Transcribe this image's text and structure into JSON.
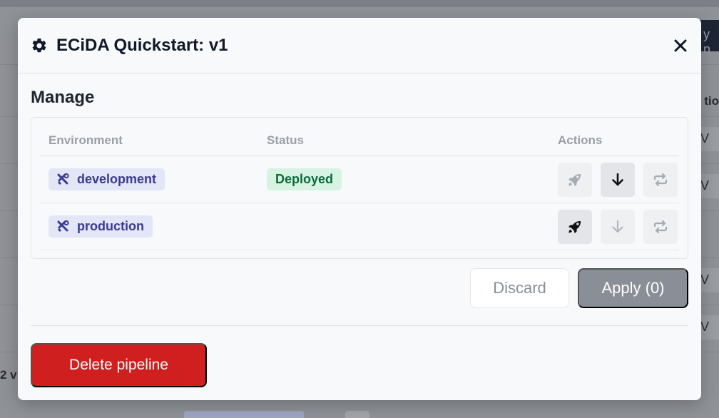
{
  "background": {
    "right_edge_text_1": "y n",
    "right_edge_text_2": "tio",
    "left_edge_text": "2 v",
    "row_v_letter": "V"
  },
  "modal": {
    "title": "ECiDA Quickstart: v1",
    "section_title": "Manage",
    "table": {
      "headers": {
        "environment": "Environment",
        "status": "Status",
        "actions": "Actions"
      },
      "rows": [
        {
          "environment": "development",
          "status": "Deployed"
        },
        {
          "environment": "production",
          "status": ""
        }
      ]
    },
    "discard_label": "Discard",
    "apply_label": "Apply (0)",
    "delete_label": "Delete pipeline"
  },
  "colors": {
    "delete": "#d01f1f",
    "env_chip_bg": "#e2e6f7",
    "env_chip_text": "#3c3a95",
    "status_bg": "#d7f4e3",
    "status_text": "#0c6a3b",
    "apply_disabled": "#8a8e96"
  },
  "icons": {
    "title": "gear-icon",
    "close": "close-icon",
    "env": "tools-icon",
    "deploy": "rocket-icon",
    "download": "arrow-down-icon",
    "redeploy": "repeat-icon"
  }
}
